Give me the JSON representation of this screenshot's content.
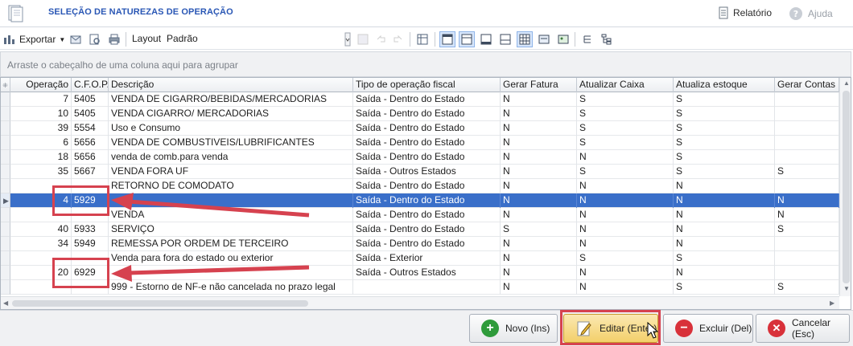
{
  "window": {
    "title": "SELEÇÃO DE NATUREZAS DE OPERAÇÃO",
    "report_label": "Relatório",
    "help_label": "Ajuda"
  },
  "toolbar": {
    "export_label": "Exportar",
    "layout_label": "Layout",
    "layout_value": "Padrão"
  },
  "group_panel": {
    "hint": "Arraste o cabeçalho de uma coluna aqui para agrupar"
  },
  "grid": {
    "columns": [
      {
        "label": "Operação"
      },
      {
        "label": "C.F.O.P."
      },
      {
        "label": "Descrição"
      },
      {
        "label": "Tipo de operação fiscal"
      },
      {
        "label": "Gerar Fatura"
      },
      {
        "label": "Atualizar Caixa"
      },
      {
        "label": "Atualiza estoque"
      },
      {
        "label": "Gerar Contas Pagar"
      }
    ],
    "rows": [
      {
        "op": "7",
        "cfop": "5405",
        "desc": "VENDA DE CIGARRO/BEBIDAS/MERCADORIAS",
        "tipo": "Saída - Dentro do Estado",
        "fatura": "N",
        "caixa": "S",
        "estoque": "S",
        "contas": ""
      },
      {
        "op": "10",
        "cfop": "5405",
        "desc": "VENDA CIGARRO/ MERCADORIAS",
        "tipo": "Saída - Dentro do Estado",
        "fatura": "N",
        "caixa": "S",
        "estoque": "S",
        "contas": ""
      },
      {
        "op": "39",
        "cfop": "5554",
        "desc": "Uso e Consumo",
        "tipo": "Saída - Dentro do Estado",
        "fatura": "N",
        "caixa": "S",
        "estoque": "S",
        "contas": ""
      },
      {
        "op": "6",
        "cfop": "5656",
        "desc": "VENDA DE COMBUSTIVEIS/LUBRIFICANTES",
        "tipo": "Saída - Dentro do Estado",
        "fatura": "N",
        "caixa": "S",
        "estoque": "S",
        "contas": ""
      },
      {
        "op": "18",
        "cfop": "5656",
        "desc": "venda de comb.para venda",
        "tipo": "Saída - Dentro do Estado",
        "fatura": "N",
        "caixa": "N",
        "estoque": "S",
        "contas": ""
      },
      {
        "op": "35",
        "cfop": "5667",
        "desc": "VENDA FORA UF",
        "tipo": "Saída - Outros Estados",
        "fatura": "N",
        "caixa": "S",
        "estoque": "S",
        "contas": "S"
      },
      {
        "op": "",
        "cfop": "",
        "desc": "RETORNO DE COMODATO",
        "tipo": "Saída - Dentro do Estado",
        "fatura": "N",
        "caixa": "N",
        "estoque": "N",
        "contas": ""
      },
      {
        "op": "4",
        "cfop": "5929",
        "desc": "",
        "tipo": "Saída - Dentro do Estado",
        "fatura": "N",
        "caixa": "N",
        "estoque": "N",
        "contas": "N"
      },
      {
        "op": "",
        "cfop": "",
        "desc": "VENDA",
        "tipo": "Saída - Dentro do Estado",
        "fatura": "N",
        "caixa": "N",
        "estoque": "N",
        "contas": "N"
      },
      {
        "op": "40",
        "cfop": "5933",
        "desc": "SERVIÇO",
        "tipo": "Saída - Dentro do Estado",
        "fatura": "S",
        "caixa": "N",
        "estoque": "N",
        "contas": "S"
      },
      {
        "op": "34",
        "cfop": "5949",
        "desc": "REMESSA POR ORDEM DE TERCEIRO",
        "tipo": "Saída - Dentro do Estado",
        "fatura": "N",
        "caixa": "N",
        "estoque": "N",
        "contas": ""
      },
      {
        "op": "",
        "cfop": "",
        "desc": "Venda para fora do estado ou exterior",
        "tipo": "Saída - Exterior",
        "fatura": "N",
        "caixa": "S",
        "estoque": "S",
        "contas": ""
      },
      {
        "op": "20",
        "cfop": "6929",
        "desc": "",
        "tipo": "Saída - Outros Estados",
        "fatura": "N",
        "caixa": "N",
        "estoque": "N",
        "contas": ""
      },
      {
        "op": "",
        "cfop": "",
        "desc": "999 - Estorno de NF-e não cancelada no prazo legal",
        "tipo": "",
        "fatura": "N",
        "caixa": "N",
        "estoque": "S",
        "contas": "S"
      }
    ],
    "selected_row": 7
  },
  "buttons": {
    "novo": "Novo (Ins)",
    "editar": "Editar (Enter)",
    "excluir": "Excluir (Del)",
    "cancelar": "Cancelar (Esc)"
  },
  "colors": {
    "title": "#2a57b5",
    "selection": "#3a6fc9",
    "annotation": "#d6424f"
  }
}
